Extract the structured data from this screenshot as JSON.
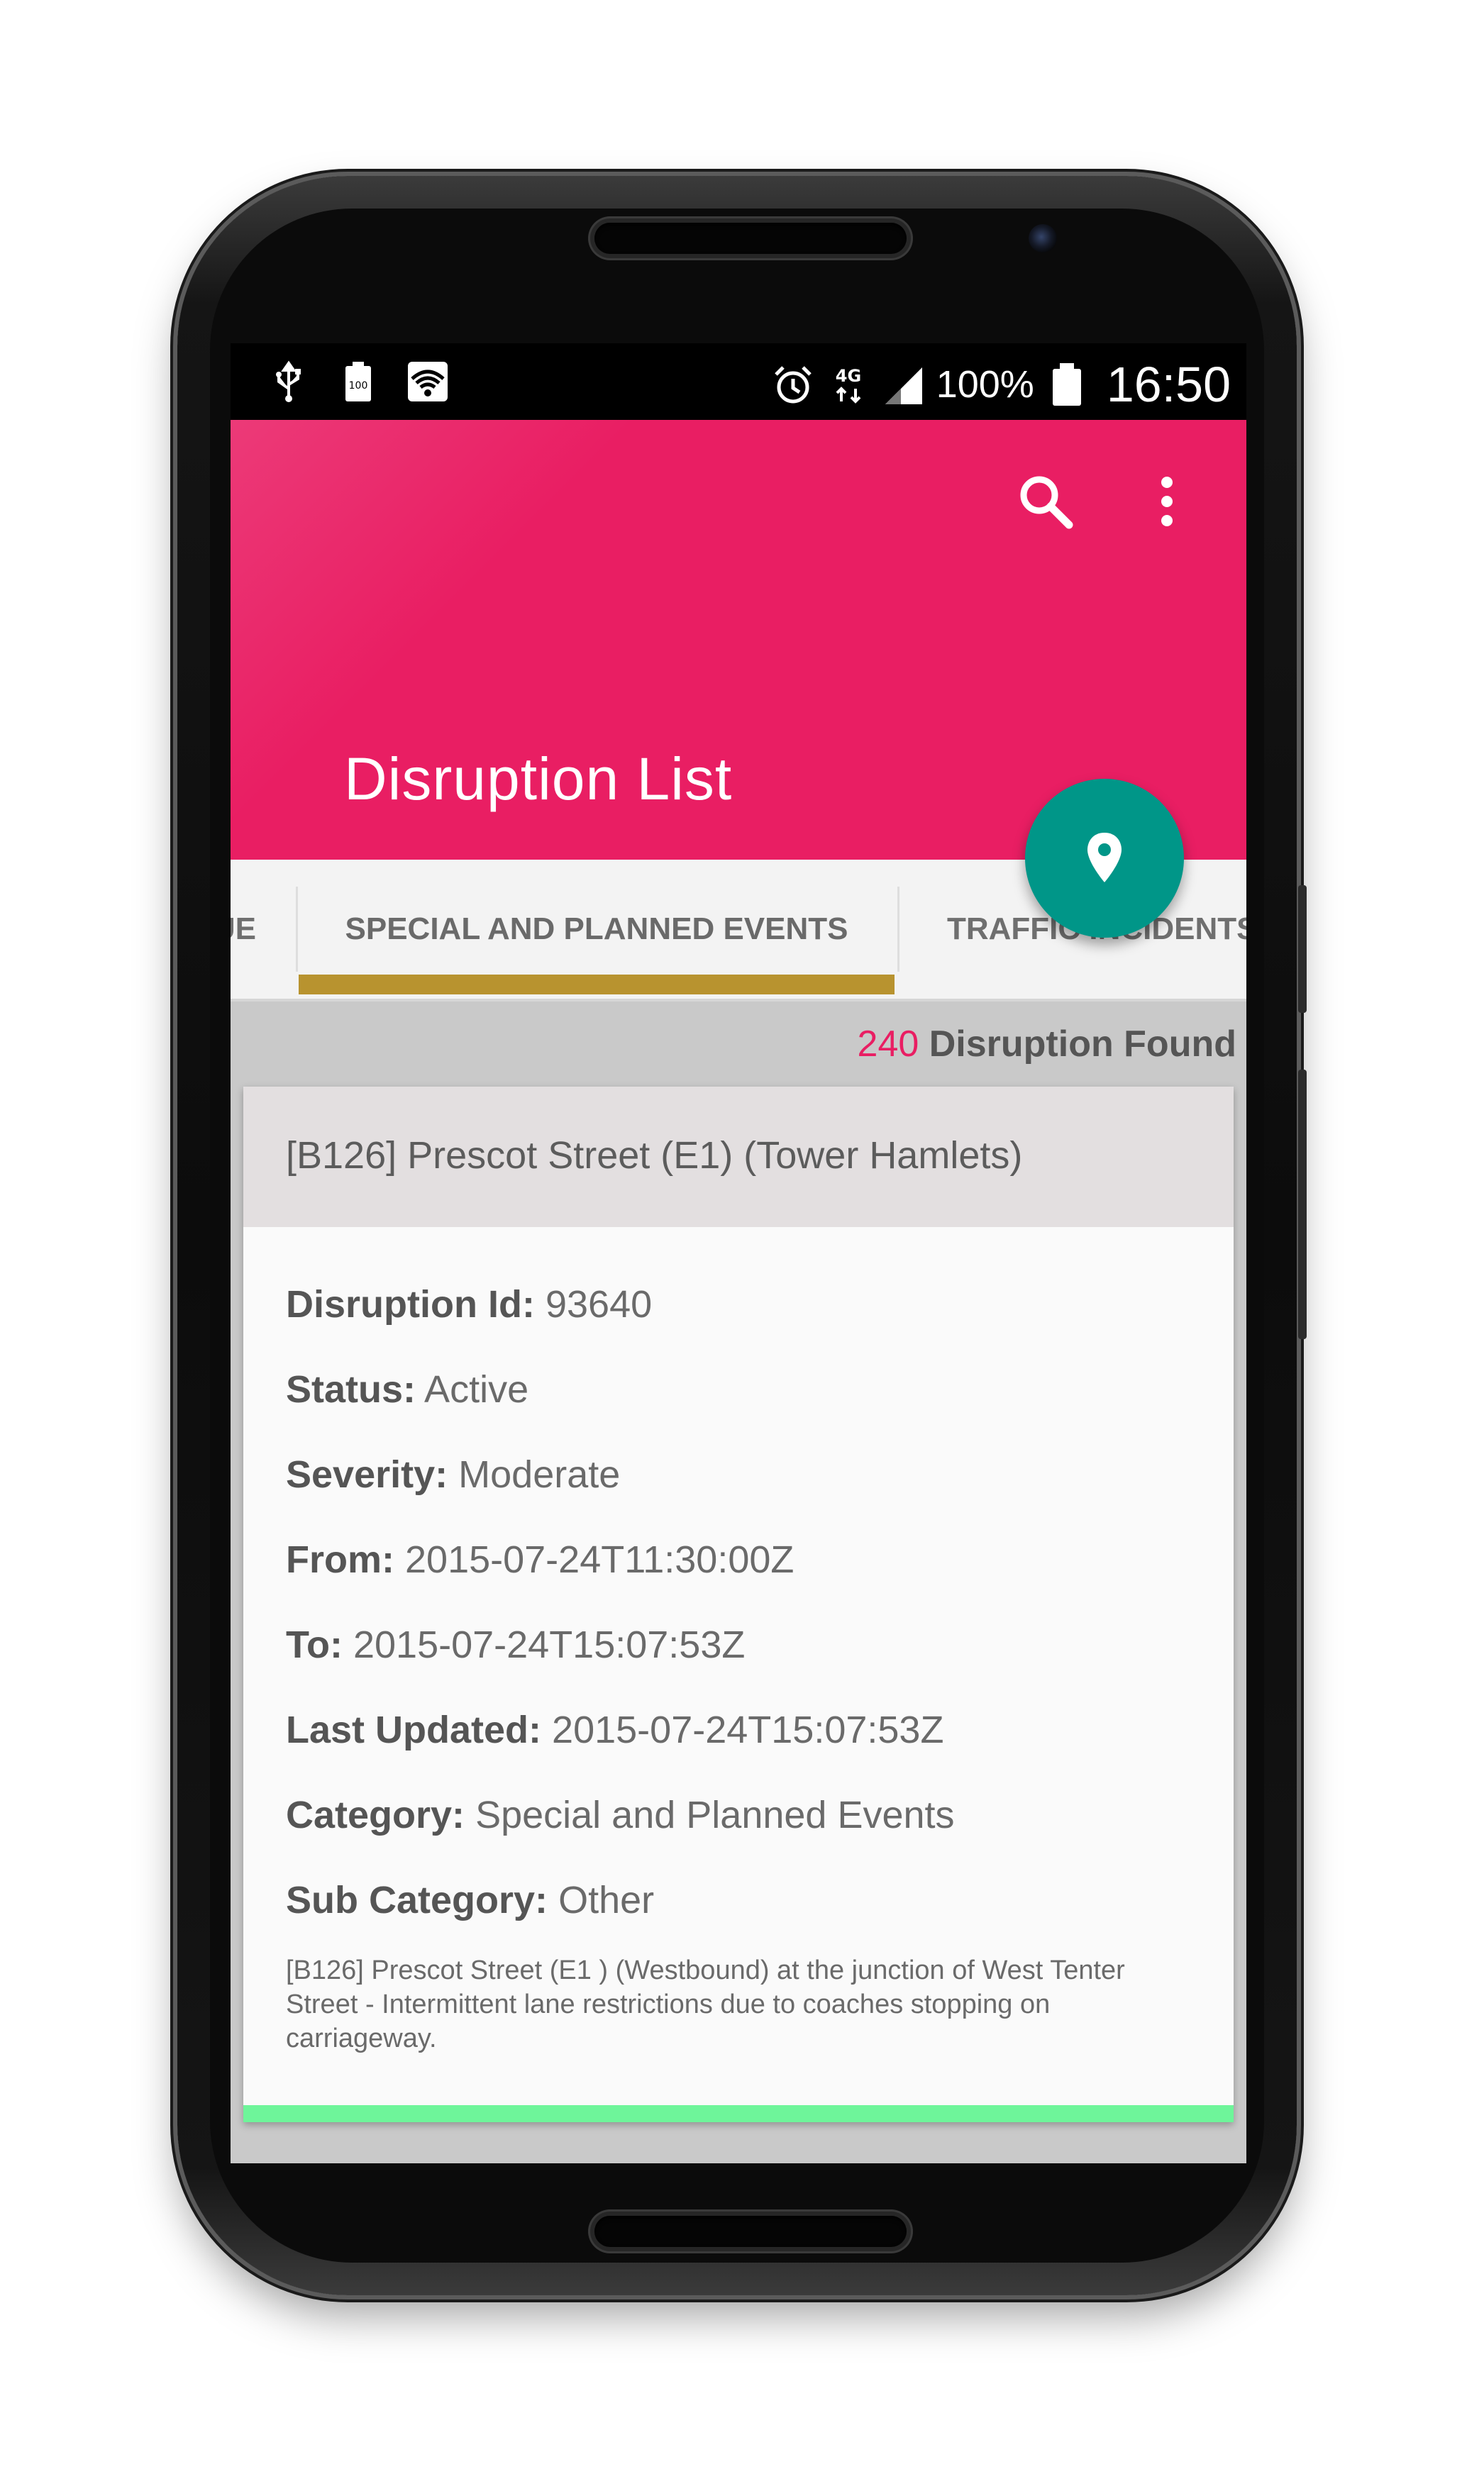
{
  "status_bar": {
    "battery_percent": "100%",
    "network": "4G",
    "time": "16:50",
    "icons": [
      "usb-icon",
      "battery-100-icon",
      "wifi-icon",
      "alarm-icon",
      "signal-icon",
      "battery-icon"
    ]
  },
  "app_bar": {
    "title": "Disruption List",
    "actions": [
      "search-icon",
      "more-vert-icon"
    ]
  },
  "fab": {
    "icon": "location-pin-icon",
    "color": "#009688"
  },
  "tabs": {
    "left_partial": "UE",
    "active": "SPECIAL AND PLANNED EVENTS",
    "right_partial": "TRAFFIC INCIDENTS",
    "indicator_color": "#b8932f"
  },
  "results": {
    "count": "240",
    "label": "Disruption Found"
  },
  "card": {
    "heading": "[B126] Prescot Street (E1) (Tower Hamlets)",
    "fields": [
      {
        "label": "Disruption Id:",
        "value": "93640"
      },
      {
        "label": "Status:",
        "value": "Active"
      },
      {
        "label": "Severity:",
        "value": "Moderate"
      },
      {
        "label": "From:",
        "value": "2015-07-24T11:30:00Z"
      },
      {
        "label": "To:",
        "value": "2015-07-24T15:07:53Z"
      },
      {
        "label": "Last Updated:",
        "value": "2015-07-24T15:07:53Z"
      },
      {
        "label": "Category:",
        "value": "Special and Planned Events"
      },
      {
        "label": "Sub Category:",
        "value": "Other"
      }
    ],
    "description": "[B126] Prescot Street (E1 ) (Westbound) at the junction of West Tenter Street - Intermittent lane restrictions due to coaches stopping on carriageway.",
    "accent_color": "#6ef59a"
  },
  "colors": {
    "primary": "#e91e63",
    "accent": "#009688"
  }
}
